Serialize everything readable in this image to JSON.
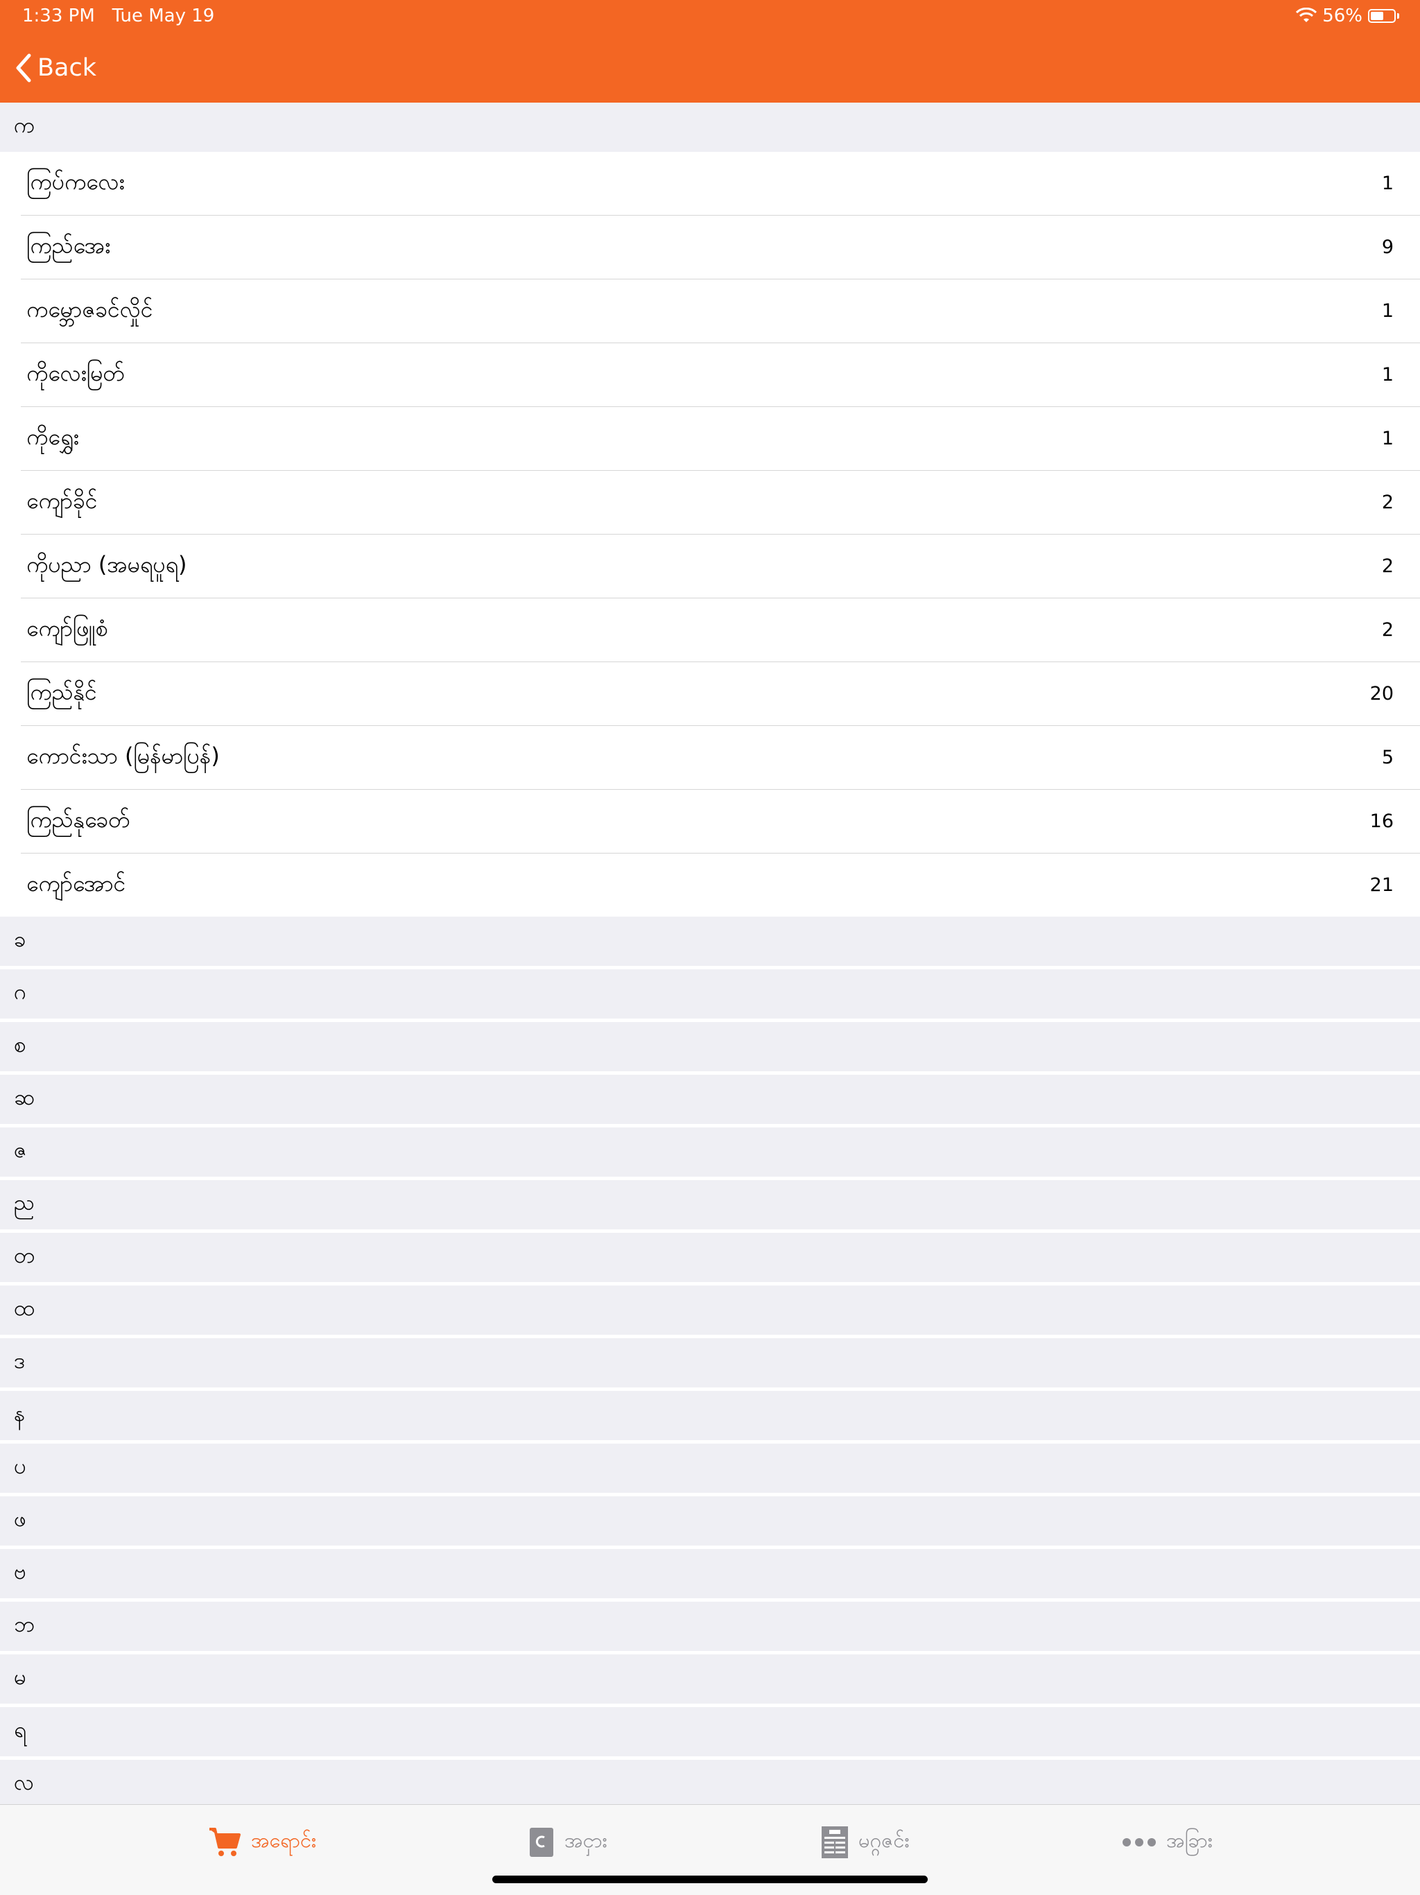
{
  "status_bar": {
    "time": "1:33 PM",
    "date": "Tue May 19",
    "battery": "56%",
    "battery_level": 0.56
  },
  "nav": {
    "back_label": "Back"
  },
  "sections": [
    {
      "letter": "က",
      "rows": [
        {
          "name": "ကြပ်ကလေး",
          "count": "1"
        },
        {
          "name": "ကြည်အေး",
          "count": "9"
        },
        {
          "name": "ကမ္ဘောဇခင်လှိုင်",
          "count": "1"
        },
        {
          "name": "ကိုလေးမြတ်",
          "count": "1"
        },
        {
          "name": "ကိုရွှေး",
          "count": "1"
        },
        {
          "name": "ကျော်ခိုင်",
          "count": "2"
        },
        {
          "name": "ကိုပညာ (အမရပူရ)",
          "count": "2"
        },
        {
          "name": "ကျော်ဖြူစံ",
          "count": "2"
        },
        {
          "name": "ကြည်နိုင်",
          "count": "20"
        },
        {
          "name": "ကောင်းသာ (မြန်မာပြန်)",
          "count": "5"
        },
        {
          "name": "ကြည်နုခေတ်",
          "count": "16"
        },
        {
          "name": "ကျော်အောင်",
          "count": "21"
        }
      ]
    },
    {
      "letter": "ခ"
    },
    {
      "letter": "ဂ"
    },
    {
      "letter": "စ"
    },
    {
      "letter": "ဆ"
    },
    {
      "letter": "ဇ"
    },
    {
      "letter": "ည"
    },
    {
      "letter": "တ"
    },
    {
      "letter": "ထ"
    },
    {
      "letter": "ဒ"
    },
    {
      "letter": "န"
    },
    {
      "letter": "ပ"
    },
    {
      "letter": "ဖ"
    },
    {
      "letter": "ဗ"
    },
    {
      "letter": "ဘ"
    },
    {
      "letter": "မ"
    },
    {
      "letter": "ရ"
    },
    {
      "letter": "လ"
    }
  ],
  "tabs": [
    {
      "label": "အရောင်း",
      "icon": "cart-icon",
      "active": true
    },
    {
      "label": "အငှား",
      "icon": "book-icon",
      "active": false
    },
    {
      "label": "မဂ္ဂဇင်း",
      "icon": "magazine-icon",
      "active": false
    },
    {
      "label": "အခြား",
      "icon": "more-icon",
      "active": false
    }
  ],
  "colors": {
    "accent": "#f36623",
    "background": "#efeff4",
    "inactive": "#8e8e93"
  }
}
